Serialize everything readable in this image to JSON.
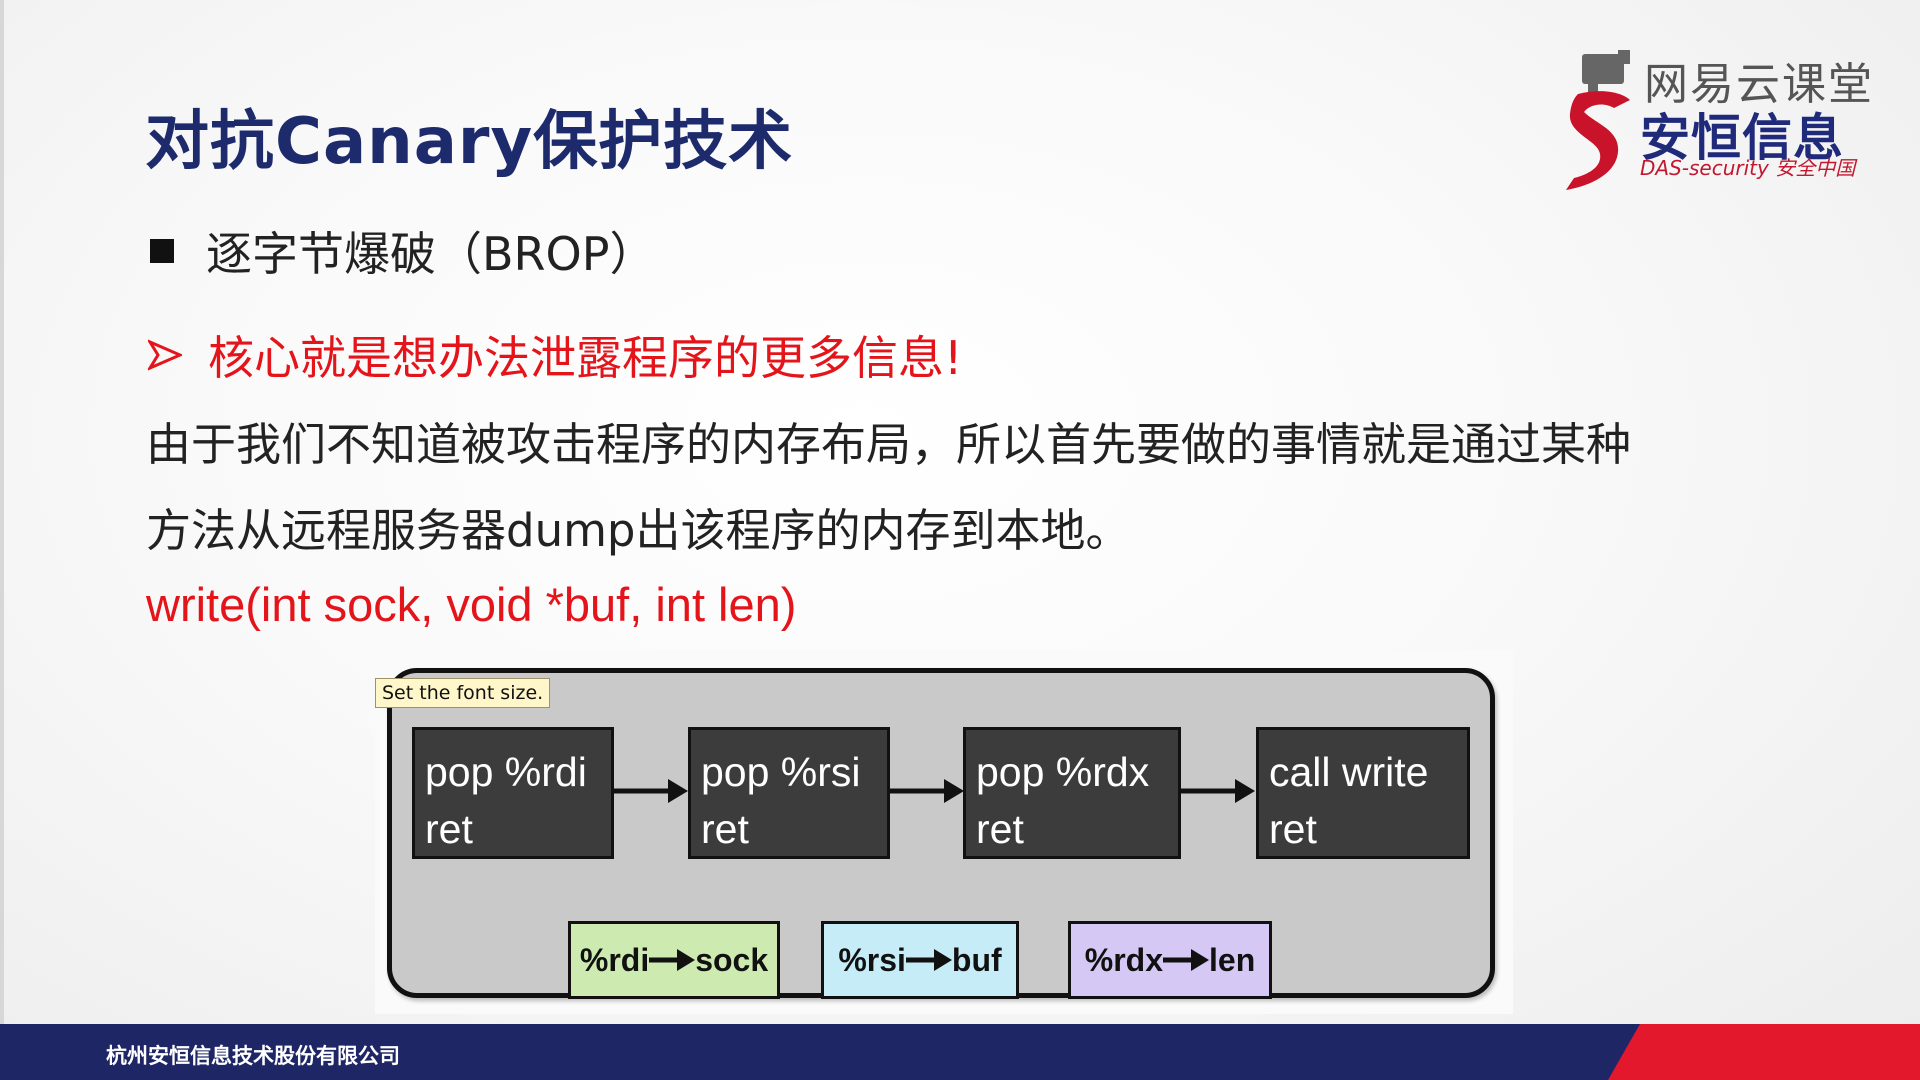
{
  "slide": {
    "title": "对抗Canary保护技术",
    "bullet": "逐字节爆破（BROP）",
    "highlight": "核心就是想办法泄露程序的更多信息!",
    "paragraph_line1": "由于我们不知道被攻击程序的内存布局，所以首先要做的事情就是通过某种",
    "paragraph_line2": "方法从远程服务器dump出该程序的内存到本地。",
    "code": "write(int sock, void *buf, int len)"
  },
  "logo": {
    "top_text": "网易云课堂",
    "main_text": "安恒信息",
    "sub_text": "DAS-security 安全中国"
  },
  "diagram": {
    "tooltip": "Set the font size.",
    "gadgets": [
      {
        "line1": "pop %rdi",
        "line2": "ret"
      },
      {
        "line1": "pop %rsi",
        "line2": "ret"
      },
      {
        "line1": "pop %rdx",
        "line2": "ret"
      },
      {
        "line1": "call write",
        "line2": "ret"
      }
    ],
    "registers": [
      {
        "reg": "%rdi",
        "val": "sock",
        "color": "#cdebb0"
      },
      {
        "reg": "%rsi",
        "val": "buf",
        "color": "#c5ecf7"
      },
      {
        "reg": "%rdx",
        "val": "len",
        "color": "#d5c8f4"
      }
    ]
  },
  "footer": {
    "company": "杭州安恒信息技术股份有限公司"
  },
  "colors": {
    "title": "#1d2a6b",
    "accent_red": "#e4141b",
    "footer_blue": "#1e2666",
    "footer_red": "#e3182d"
  }
}
